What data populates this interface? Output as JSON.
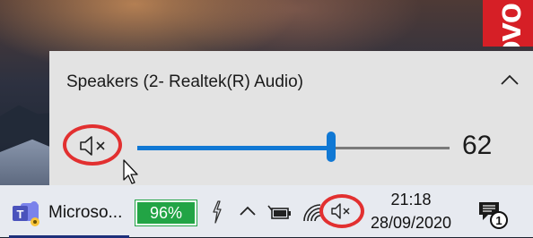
{
  "desktop": {
    "brand_text": "enovo"
  },
  "volume_flyout": {
    "device_name": "Speakers (2- Realtek(R) Audio)",
    "volume_value": "62",
    "volume_level": 0.62,
    "muted": true,
    "accent_color": "#1078d4",
    "highlight_color": "#e23030"
  },
  "taskbar": {
    "app_label": "Microso...",
    "battery_percent": "96%",
    "clock": {
      "time": "21:18",
      "date": "28/09/2020"
    },
    "notification_count": "1",
    "icons": [
      "teams-icon",
      "battery-charging-icon",
      "show-hidden-icons-chevron",
      "power-plug-icon",
      "wifi-icon",
      "speaker-muted-icon",
      "action-center-icon"
    ]
  }
}
